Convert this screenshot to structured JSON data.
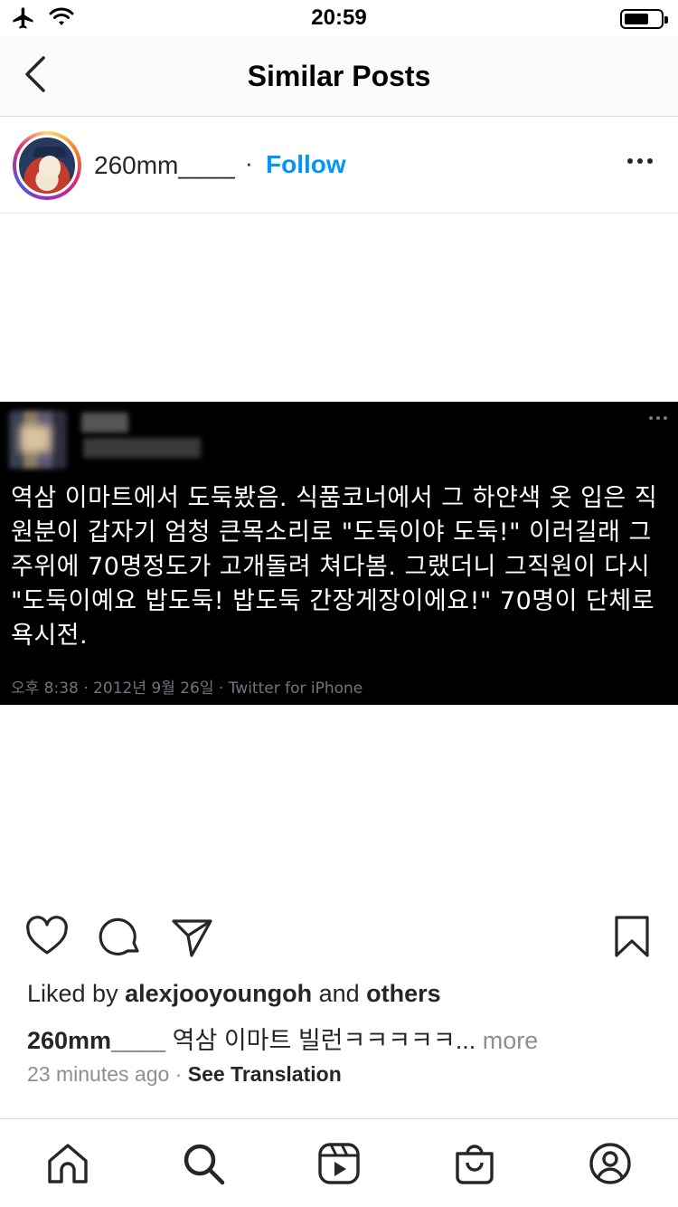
{
  "status_bar": {
    "time": "20:59",
    "icons": [
      "airplane-icon",
      "wifi-icon",
      "battery-icon"
    ]
  },
  "nav": {
    "title": "Similar Posts",
    "back_icon": "chevron-left-icon"
  },
  "post": {
    "username": "260mm____",
    "separator": " · ",
    "follow_label": "Follow",
    "more_icon": "more-horizontal-icon",
    "tweet": {
      "text": "역삼 이마트에서 도둑봤음. 식품코너에서 그 하얀색 옷 입은 직원분이 갑자기 엄청 큰목소리로 \"도둑이야 도둑!\" 이러길래 그주위에 70명정도가 고개돌려 쳐다봄. 그랬더니 그직원이 다시 \"도둑이예요 밥도둑! 밥도둑 간장게장이에요!\" 70명이 단체로 욕시전.",
      "meta": "오후 8:38 · 2012년 9월 26일 · Twitter for iPhone"
    },
    "liked": {
      "prefix": "Liked by ",
      "user": "alexjooyoungoh",
      "middle": " and ",
      "others": "others"
    },
    "caption": {
      "username": "260mm____",
      "text": " 역삼 이마트 빌런ㅋㅋㅋㅋㅋ...",
      "more": " more"
    },
    "time_ago": "23 minutes ago",
    "see_translation": "See Translation"
  },
  "colors": {
    "accent": "#0095f6",
    "text": "#262626",
    "muted": "#8e8e8e"
  },
  "tabs": [
    "home-icon",
    "search-icon",
    "reels-icon",
    "shop-icon",
    "profile-icon"
  ]
}
